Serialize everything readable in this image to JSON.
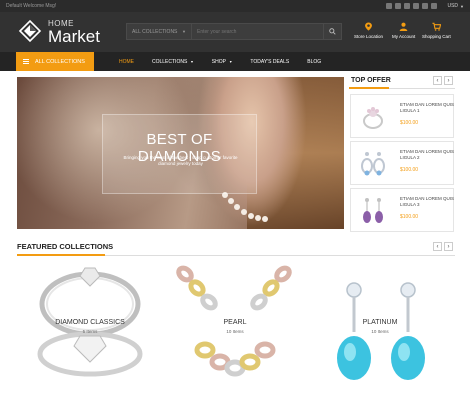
{
  "topbar": {
    "welcome": "Default Welcome Msg!",
    "currency": "USD"
  },
  "logo": {
    "line1": "HOME",
    "line2": "Market"
  },
  "search": {
    "category": "ALL COLLECTIONS",
    "placeholder": "Enter your search"
  },
  "header_links": [
    {
      "label": "Store Location",
      "icon": "map-pin-icon"
    },
    {
      "label": "My Account",
      "icon": "user-icon"
    },
    {
      "label": "Shopping Cart",
      "icon": "cart-icon"
    }
  ],
  "nav": {
    "all_collections": "ALL COLLECTIONS",
    "items": [
      "HOME",
      "COLLECTIONS",
      "SHOP",
      "TODAY'S DEALS",
      "BLOG"
    ],
    "active_index": 0
  },
  "hero": {
    "title": "BEST OF DIAMONDS",
    "subtitle": "Bringing you the best of the best - shop customer favorite diamond jewelry today"
  },
  "top_offer": {
    "title": "TOP OFFER",
    "products": [
      {
        "name": "ETIAM DAN LOREM QUIS LIGULA 1",
        "price": "$100.00"
      },
      {
        "name": "ETIAM DAN LOREM QUIS LIGULA 2",
        "price": "$100.00"
      },
      {
        "name": "ETIAM DAN LOREM QUIS LIGULA 3",
        "price": "$100.00"
      }
    ]
  },
  "featured": {
    "title": "FEATURED COLLECTIONS",
    "items": [
      {
        "label": "DIAMOND CLASSICS",
        "count": "5 Items"
      },
      {
        "label": "PEARL",
        "count": "10 Items"
      },
      {
        "label": "PLATINUM",
        "count": "10 Items"
      }
    ]
  },
  "colors": {
    "accent": "#f39c12",
    "header": "#323232",
    "navbar": "#242424"
  }
}
